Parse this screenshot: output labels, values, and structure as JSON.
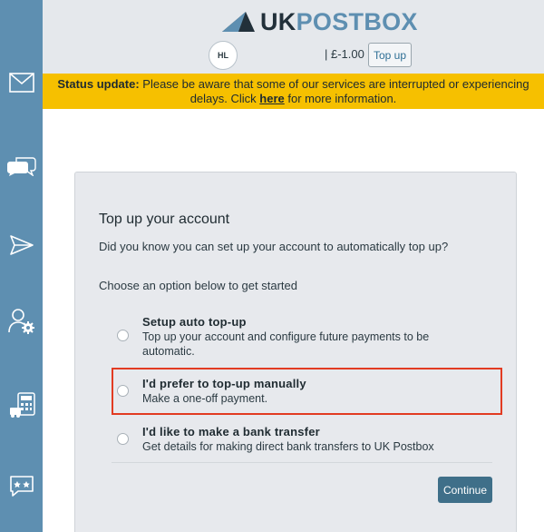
{
  "brand": {
    "logo_uk": "UK",
    "logo_post": "POSTBOX",
    "logo_icon": "paper-plane-logo-icon"
  },
  "header": {
    "avatar_initials": "HL",
    "balance": "| £-1.00",
    "topup_label": "Top up"
  },
  "sidebar": {
    "items": [
      {
        "name": "mail",
        "icon": "envelope-icon"
      },
      {
        "name": "messages",
        "icon": "chat-bubbles-icon"
      },
      {
        "name": "send",
        "icon": "paper-plane-icon"
      },
      {
        "name": "account-settings",
        "icon": "user-gear-icon"
      },
      {
        "name": "billing",
        "icon": "calculator-icon"
      },
      {
        "name": "feedback",
        "icon": "star-speech-icon"
      }
    ]
  },
  "banner": {
    "label": "Status update:",
    "text_before": " Please be aware that some of our services are interrupted or experiencing delays. Click ",
    "link_text": "here",
    "text_after": " for more information."
  },
  "topup_card": {
    "title": "Top up your account",
    "intro": "Did you know you can set up your account to automatically top up?",
    "choose": "Choose an option below to get started",
    "options": [
      {
        "title": "Setup auto top-up",
        "desc": "Top up your account and configure future payments to be automatic."
      },
      {
        "title": "I'd prefer to top-up manually",
        "desc": "Make a one-off payment."
      },
      {
        "title": "I'd like to make a bank transfer",
        "desc": "Get details for making direct bank transfers to UK Postbox"
      }
    ],
    "continue_label": "Continue"
  },
  "colors": {
    "sidebar": "#5e8fb1",
    "banner": "#f6c000",
    "header": "#e5e8ec",
    "card": "#e7e9ed",
    "continue_button": "#3f6f89",
    "highlight": "#e23b22"
  }
}
